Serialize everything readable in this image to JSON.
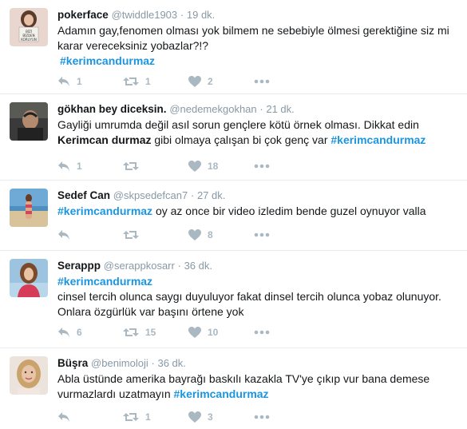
{
  "tweets": [
    {
      "fullname": "pokerface",
      "username": "@twiddle1903",
      "time": "19 dk.",
      "text_parts": [
        "Adamın gay,fenomen olması yok bilmem ne sebebiyle ölmesi gerektiğine siz mi karar vereceksiniz yobazlar?!?"
      ],
      "hashtag": "#kerimcandurmaz",
      "reply_count": "1",
      "retweet_count": "1",
      "like_count": "2",
      "avatar_sign_text": "BİZİ BİZDEN KORUYUN",
      "avatar_colors": {
        "bg": "#e9d7cf",
        "sign": "#f4f1ea",
        "hair": "#5b3b2c"
      }
    },
    {
      "fullname": "gökhan bey diceksin.",
      "username": "@nedemekgokhan",
      "time": "21 dk.",
      "text_before": "Gayliği umrumda değil asıl sorun gençlere kötü örnek olması. Dikkat edin ",
      "text_bold": "Kerimcan durmaz",
      "text_after": " gibi olmaya çalışan bi çok genç var ",
      "hashtag": "#kerimcandurmaz",
      "reply_count": "1",
      "retweet_count": "",
      "like_count": "18",
      "avatar_colors": {
        "bg": "#3a3a3a",
        "face": "#b48a6e"
      }
    },
    {
      "fullname": "Sedef Can",
      "username": "@skpsedefcan7",
      "time": "27 dk.",
      "hashtag": "#kerimcandurmaz",
      "text_after": " oy az once bir video izledim bende guzel oynuyor valla",
      "reply_count": "",
      "retweet_count": "",
      "like_count": "8",
      "avatar_colors": {
        "bg": "#6fa9d6",
        "sand": "#d9c39a",
        "body": "#c97b7b"
      }
    },
    {
      "fullname": "Serappp",
      "username": "@serappkosarr",
      "time": "36 dk.",
      "hashtag": "#kerimcandurmaz",
      "text_after": " cinsel tercih olunca saygı duyuluyor fakat dinsel tercih olunca yobaz olunuyor. Onlara özgürlük var başını örtene yok",
      "reply_count": "6",
      "retweet_count": "15",
      "like_count": "10",
      "avatar_colors": {
        "bg": "#9cc4e0",
        "hair": "#7a4a2a",
        "shirt": "#d63b57"
      }
    },
    {
      "fullname": "Büşra",
      "username": "@benimoloji",
      "time": "36 dk.",
      "text_before": "Abla üstünde amerika bayrağı baskılı kazakla TV'ye çıkıp vur bana demese vurmazlardı uzatmayın ",
      "hashtag": "#kerimcandurmaz",
      "reply_count": "",
      "retweet_count": "1",
      "like_count": "3",
      "avatar_colors": {
        "bg": "#ece4dc",
        "hair": "#c9a36b",
        "face": "#e8c4a8"
      }
    }
  ],
  "colors": {
    "hashtag": "#1b95e0",
    "muted": "#8899a6",
    "icon": "#aab8c2",
    "divider": "#e6ecf0"
  },
  "icons": {
    "reply": "reply-arrow-icon",
    "retweet": "retweet-icon",
    "like": "heart-icon",
    "more": "more-dots-icon"
  }
}
